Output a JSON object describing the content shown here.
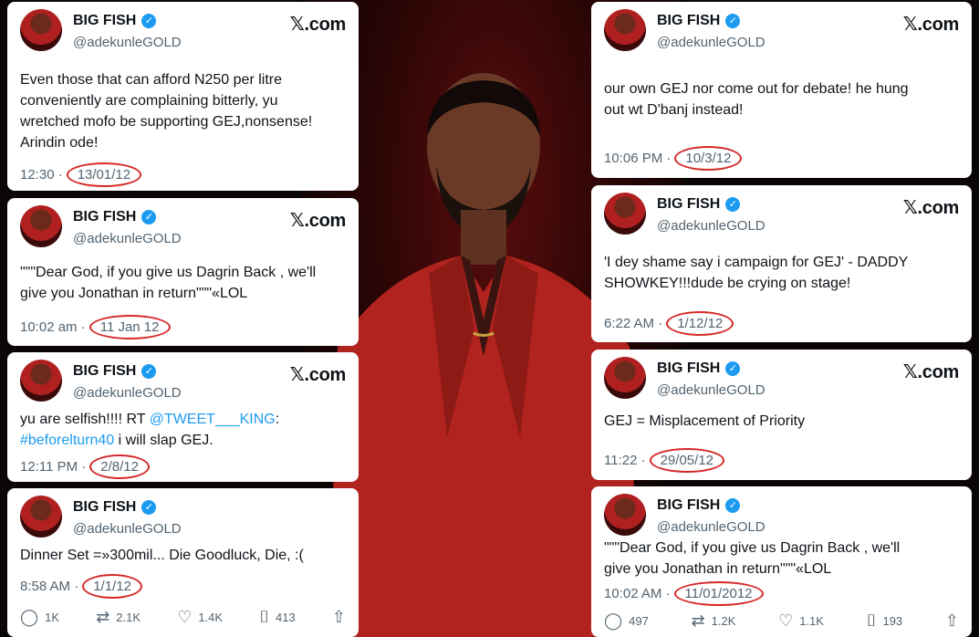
{
  "author": {
    "name": "BIG FISH",
    "handle": "@adekunleGOLD",
    "verified_icon": "verified-badge-icon",
    "source": "𝕏.com"
  },
  "left_tweets": [
    {
      "lines": [
        "Even those that can afford N250 per litre",
        "conveniently are complaining bitterly, yu",
        "wretched mofo be supporting GEJ,nonsense!",
        "Arindin ode!"
      ],
      "time": "12:30 ·",
      "date": "13/01/12"
    },
    {
      "lines": [
        "\"\"\"Dear God, if you give us Dagrin Back , we'll",
        "give you Jonathan in return\"\"\"«LOL"
      ],
      "time": "10:02 am ·",
      "date": "11 Jan 12"
    },
    {
      "line1_text": "yu are selfish!!!! RT ",
      "line1_mention": "@TWEET___KING",
      "line1_colon": ":",
      "line2_hashtag": "#beforelturn40",
      "line2_rest": " i will slap GEJ.",
      "time": "12:11 PM ·",
      "date": "2/8/12"
    },
    {
      "lines": [
        "Dinner Set =»300mil... Die Goodluck, Die, :("
      ],
      "time": "8:58 AM ·",
      "date": "1/1/12",
      "stats": {
        "replies": "1K",
        "reposts": "2.1K",
        "likes": "1.4K",
        "bookmarks": "413"
      }
    }
  ],
  "right_tweets": [
    {
      "lines": [
        "our own GEJ nor come out for debate! he hung",
        "out wt D'banj instead!"
      ],
      "time": "10:06 PM ·",
      "date": "10/3/12"
    },
    {
      "lines": [
        "'I dey shame say i campaign for GEJ' - DADDY",
        "SHOWKEY!!!dude be crying on stage!"
      ],
      "time": "6:22 AM ·",
      "date": "1/12/12"
    },
    {
      "lines": [
        "GEJ = Misplacement of Priority"
      ],
      "time": "11:22 ·",
      "date": "29/05/12"
    },
    {
      "lines": [
        "\"\"\"Dear God, if you give us Dagrin Back , we'll",
        "give you Jonathan in return\"\"\"«LOL"
      ],
      "time": "10:02 AM ·",
      "date": "11/01/2012",
      "stats": {
        "replies": "497",
        "reposts": "1.2K",
        "likes": "1.1K",
        "bookmarks": "193"
      }
    }
  ],
  "colors": {
    "accent": "#1d9bf0",
    "highlight_circle": "#d62828",
    "background": "#0a0606"
  }
}
